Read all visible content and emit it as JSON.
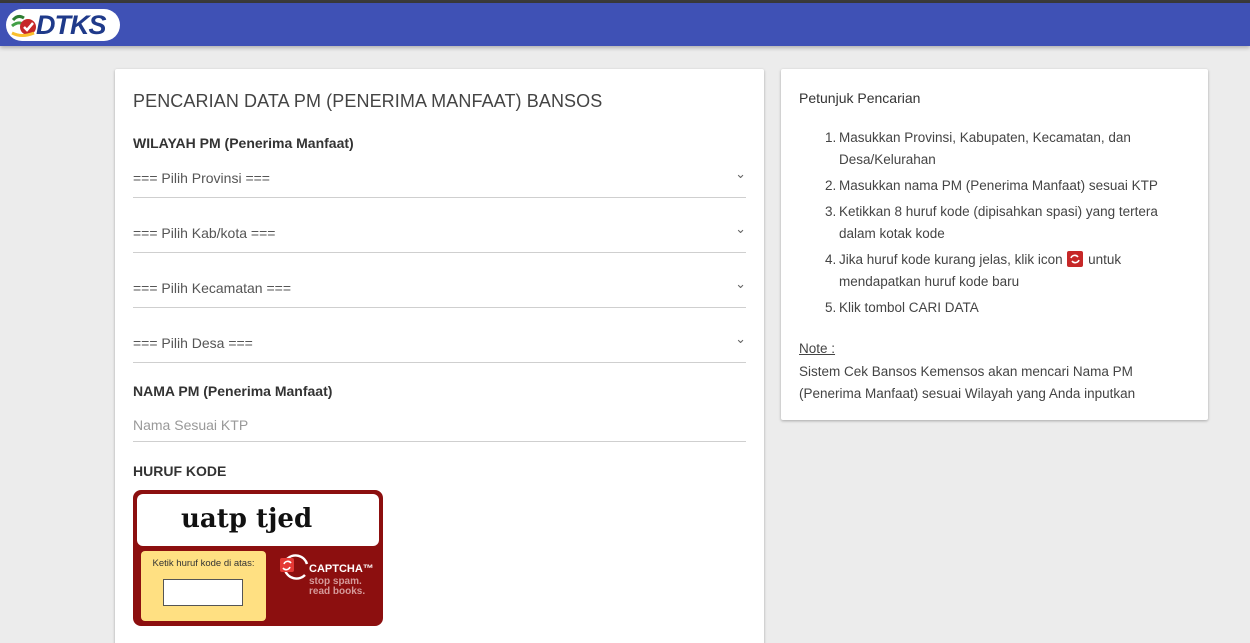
{
  "header": {
    "logo_text": "DTKS",
    "brand_color": "#3f51b5"
  },
  "form": {
    "title": "PENCARIAN DATA PM (PENERIMA MANFAAT) BANSOS",
    "wilayah_label": "WILAYAH PM (Penerima Manfaat)",
    "selects": [
      "=== Pilih Provinsi ===",
      "=== Pilih Kab/kota ===",
      "=== Pilih Kecamatan ===",
      "=== Pilih Desa ==="
    ],
    "nama_label": "NAMA PM (Penerima Manfaat)",
    "nama_placeholder": "Nama Sesuai KTP",
    "kode_label": "HURUF KODE"
  },
  "captcha": {
    "word": "uatp tjed",
    "input_label": "Ketik huruf kode di atas:",
    "brand": "CAPTCHA™",
    "tagline_1": "stop spam.",
    "tagline_2": "read books.",
    "frame_color": "#8c0f0f"
  },
  "guide": {
    "title": "Petunjuk Pencarian",
    "steps": [
      {
        "num": "1.",
        "text": "Masukkan Provinsi, Kabupaten, Kecamatan, dan Desa/Kelurahan"
      },
      {
        "num": "2.",
        "text": "Masukkan nama PM (Penerima Manfaat) sesuai KTP"
      },
      {
        "num": "3.",
        "text": "Ketikkan 8 huruf kode (dipisahkan spasi) yang tertera dalam kotak kode"
      },
      {
        "num": "4.",
        "text_before": "Jika huruf kode kurang jelas, klik icon",
        "text_after": "untuk mendapatkan huruf kode baru"
      },
      {
        "num": "5.",
        "text": "Klik tombol CARI DATA"
      }
    ],
    "note_label": "Note :",
    "note_text": "Sistem Cek Bansos Kemensos akan mencari Nama PM (Penerima Manfaat) sesuai Wilayah yang Anda inputkan"
  }
}
